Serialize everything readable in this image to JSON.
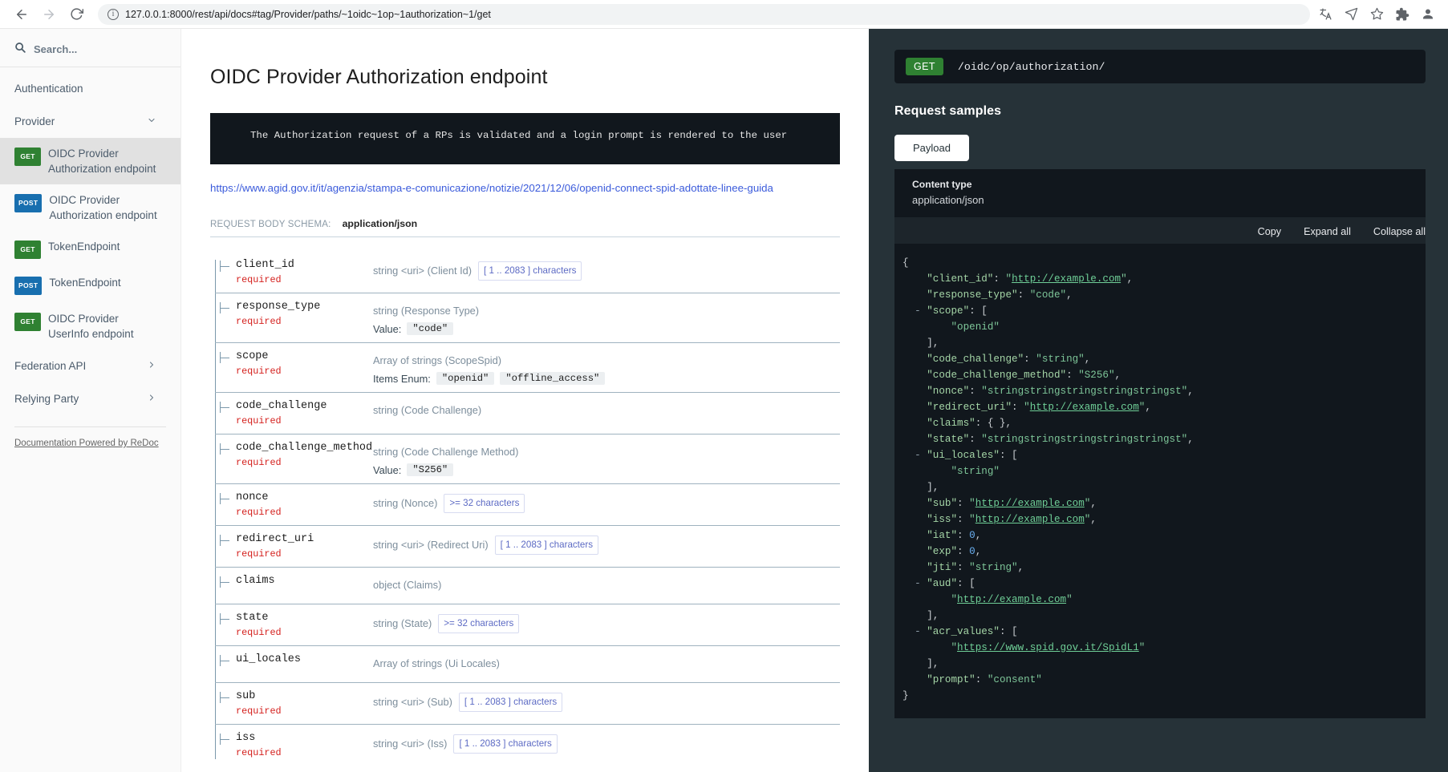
{
  "browser": {
    "back_icon": "back-arrow-icon",
    "forward_icon": "forward-arrow-icon",
    "reload_icon": "reload-icon",
    "url": "127.0.0.1:8000/rest/api/docs#tag/Provider/paths/~1oidc~1op~1authorization~1/get",
    "translate_icon": "translate-icon",
    "send_icon": "send-icon",
    "star_icon": "bookmark-star-icon",
    "extensions_icon": "extensions-puzzle-icon",
    "profile_icon": "profile-avatar-icon"
  },
  "sidebar": {
    "search_placeholder": "Search...",
    "search_value": "",
    "groups": [
      {
        "label": "Authentication",
        "expandable": false
      },
      {
        "label": "Provider",
        "expandable": true,
        "chevron": "chevron-down-icon"
      }
    ],
    "items": [
      {
        "method": "GET",
        "label": "OIDC Provider Authorization endpoint",
        "active": true
      },
      {
        "method": "POST",
        "label": "OIDC Provider Authorization endpoint",
        "active": false
      },
      {
        "method": "GET",
        "label": "TokenEndpoint",
        "active": false
      },
      {
        "method": "POST",
        "label": "TokenEndpoint",
        "active": false
      },
      {
        "method": "GET",
        "label": "OIDC Provider UserInfo endpoint",
        "active": false
      }
    ],
    "trailing_groups": [
      {
        "label": "Federation API",
        "chevron": "chevron-right-icon"
      },
      {
        "label": "Relying Party",
        "chevron": "chevron-right-icon"
      }
    ],
    "footer_link": "Documentation Powered by ReDoc"
  },
  "main": {
    "title": "OIDC Provider Authorization endpoint",
    "description": "The Authorization request of a RPs is validated and a login prompt is rendered to the user",
    "reference_link": "https://www.agid.gov.it/it/agenzia/stampa-e-comunicazione/notizie/2021/12/06/openid-connect-spid-adottate-linee-guida",
    "schema_label": "REQUEST BODY SCHEMA:",
    "schema_value": "application/json",
    "params": [
      {
        "name": "client_id",
        "required": "required",
        "type": "string <uri> (Client Id)",
        "chip": "[ 1 .. 2083 ] characters"
      },
      {
        "name": "response_type",
        "required": "required",
        "type": "string (Response Type)",
        "value_label": "Value:",
        "enums": [
          "\"code\""
        ]
      },
      {
        "name": "scope",
        "required": "required",
        "type": "Array of strings (ScopeSpid)",
        "value_label": "Items Enum:",
        "enums": [
          "\"openid\"",
          "\"offline_access\""
        ]
      },
      {
        "name": "code_challenge",
        "required": "required",
        "type": "string (Code Challenge)"
      },
      {
        "name": "code_challenge_method",
        "required": "required",
        "type": "string (Code Challenge Method)",
        "value_label": "Value:",
        "enums": [
          "\"S256\""
        ]
      },
      {
        "name": "nonce",
        "required": "required",
        "type": "string (Nonce)",
        "chip": ">= 32 characters"
      },
      {
        "name": "redirect_uri",
        "required": "required",
        "type": "string <uri> (Redirect Uri)",
        "chip": "[ 1 .. 2083 ] characters"
      },
      {
        "name": "claims",
        "required": "",
        "type": "object (Claims)"
      },
      {
        "name": "state",
        "required": "required",
        "type": "string (State)",
        "chip": ">= 32 characters"
      },
      {
        "name": "ui_locales",
        "required": "",
        "type": "Array of strings (Ui Locales)"
      },
      {
        "name": "sub",
        "required": "required",
        "type": "string <uri> (Sub)",
        "chip": "[ 1 .. 2083 ] characters"
      },
      {
        "name": "iss",
        "required": "required",
        "type": "string <uri> (Iss)",
        "chip": "[ 1 .. 2083 ] characters"
      }
    ]
  },
  "right": {
    "method": "GET",
    "path": "/oidc/op/authorization/",
    "samples_title": "Request samples",
    "tab_label": "Payload",
    "content_type_label": "Content type",
    "content_type_value": "application/json",
    "actions": {
      "copy": "Copy",
      "expand": "Expand all",
      "collapse": "Collapse all"
    },
    "sample_json": {
      "client_id": "http://example.com",
      "response_type": "code",
      "scope": [
        "openid"
      ],
      "code_challenge": "string",
      "code_challenge_method": "S256",
      "nonce": "stringstringstringstringstringst",
      "redirect_uri": "http://example.com",
      "claims": {},
      "state": "stringstringstringstringstringst",
      "ui_locales": [
        "string"
      ],
      "sub": "http://example.com",
      "iss": "http://example.com",
      "iat": 0,
      "exp": 0,
      "jti": "string",
      "aud": [
        "http://example.com"
      ],
      "acr_values": [
        "https://www.spid.gov.it/SpidL1"
      ],
      "prompt": "consent"
    }
  },
  "colors": {
    "get_green": "#2f8132",
    "post_blue": "#186faf",
    "panel_dark": "#263238",
    "code_dark": "#11171d",
    "link_blue": "#3b5bdb",
    "required_red": "#d41f1c"
  }
}
